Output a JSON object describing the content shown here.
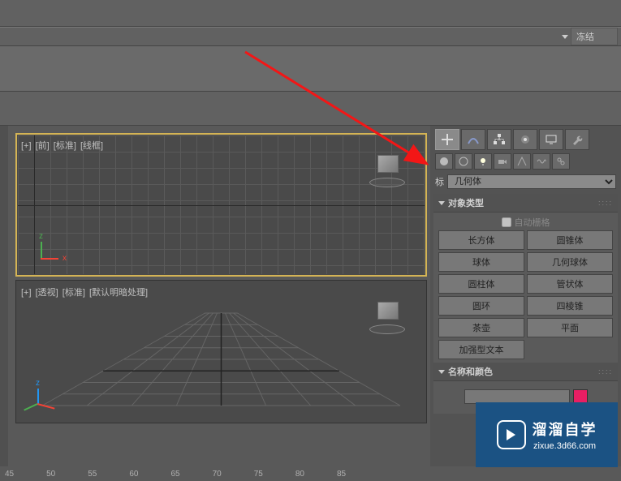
{
  "top": {
    "freeze_label": "冻结"
  },
  "viewports": {
    "front": {
      "plus": "[+]",
      "name": "[前]",
      "mode1": "[标准]",
      "mode2": "[线框]"
    },
    "perspective": {
      "plus": "[+]",
      "name": "[透视]",
      "mode1": "[标准]",
      "mode2": "[默认明暗处理]"
    }
  },
  "sidebar": {
    "category_prefix": "标",
    "category_selected": "几何体",
    "object_type_title": "对象类型",
    "autogrid_label": "自动栅格",
    "buttons": {
      "box": "长方体",
      "cone": "圆锥体",
      "sphere": "球体",
      "geosphere": "几何球体",
      "cylinder": "圆柱体",
      "tube": "管状体",
      "torus": "圆环",
      "pyramid": "四棱锥",
      "teapot": "茶壶",
      "plane": "平面",
      "textplus": "加强型文本"
    },
    "name_color_title": "名称和颜色"
  },
  "timeline": {
    "ticks": [
      "45",
      "50",
      "55",
      "60",
      "65",
      "70",
      "75",
      "80",
      "85"
    ]
  },
  "watermark": {
    "title": "溜溜自学",
    "url": "zixue.3d66.com"
  }
}
